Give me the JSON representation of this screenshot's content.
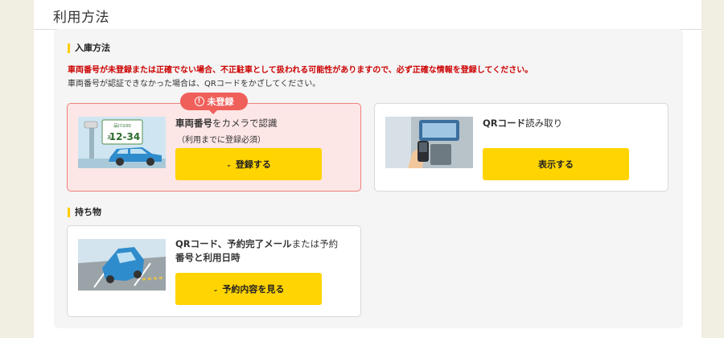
{
  "page": {
    "title": "利用方法"
  },
  "entry": {
    "heading": "入庫方法",
    "warning": "車両番号が未登録または正確でない場合、不正駐車として扱われる可能性がありますので、必ず正確な情報を登録してください。",
    "note": "車両番号が認証できなかった場合は、QRコードをかざしてください。",
    "plate_card": {
      "badge": "未登録",
      "title_bold": "車両番号",
      "title_rest": "をカメラで認識",
      "subtitle": "（利用までに登録必須）",
      "button": "登録する",
      "plate_top": "品川100",
      "plate_kana": "あ",
      "plate_number": "12-34"
    },
    "qr_card": {
      "title_bold": "QRコード",
      "title_rest": "読み取り",
      "button": "表示する"
    }
  },
  "belongings": {
    "heading": "持ち物",
    "card": {
      "line1_bold_a": "QRコード、予約完了メール",
      "line1_rest": "または予約",
      "line2_bold": "番号と利用日時",
      "button": "予約内容を見る"
    }
  },
  "colors": {
    "accent": "#ffd400",
    "warning": "#cc0000",
    "badge": "#f0605a",
    "alert_bg": "#fde6e6"
  },
  "icons": {
    "chevron": "chevron-down-icon",
    "alert": "exclamation-circle-icon"
  }
}
